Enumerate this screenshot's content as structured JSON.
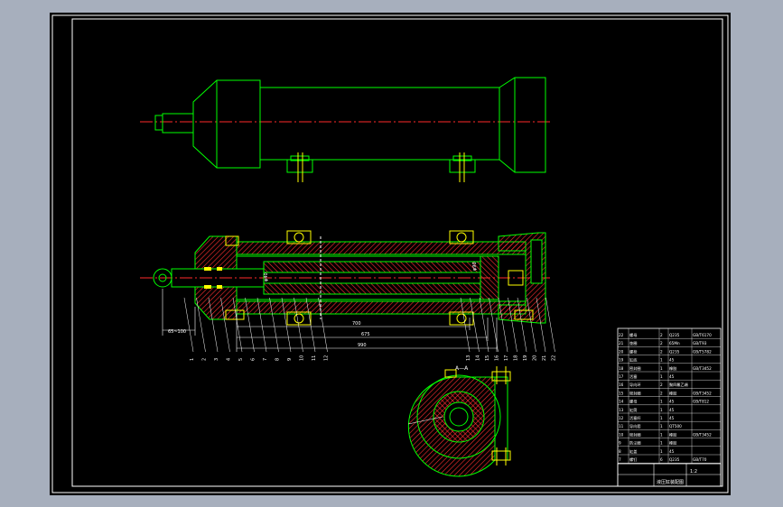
{
  "colors": {
    "background": "#a7afbd",
    "sheet": "#000000",
    "frame": "#ffffff",
    "geometry": "#00ff00",
    "centerline": "#ff2a2a",
    "hatch": "#ff3030",
    "yellow": "#ffff00",
    "text": "#ffffff"
  },
  "dimensions": {
    "stroke_dim": "65~100",
    "len_a": "700",
    "len_b": "675",
    "len_c": "990",
    "bore": "φ40",
    "rod": "φ90"
  },
  "section_mark": "A—A",
  "balloons_left": [
    "1",
    "2",
    "3",
    "4",
    "5",
    "6",
    "7",
    "8",
    "9",
    "10",
    "11",
    "12"
  ],
  "balloons_right": [
    "13",
    "14",
    "15",
    "16",
    "17",
    "18",
    "19",
    "20",
    "21",
    "22"
  ],
  "title_block": {
    "rows": [
      [
        "22",
        "螺母",
        "2",
        "Q235",
        "GB/T6170"
      ],
      [
        "21",
        "垫圈",
        "2",
        "65Mn",
        "GB/T93"
      ],
      [
        "20",
        "螺栓",
        "2",
        "Q235",
        "GB/T5782"
      ],
      [
        "19",
        "缸底",
        "1",
        "45",
        ""
      ],
      [
        "18",
        "密封圈",
        "1",
        "橡胶",
        "GB/T3452"
      ],
      [
        "17",
        "活塞",
        "1",
        "45",
        ""
      ],
      [
        "16",
        "导向环",
        "2",
        "聚四氟乙烯",
        ""
      ],
      [
        "15",
        "密封圈",
        "2",
        "橡胶",
        "GB/T3452"
      ],
      [
        "14",
        "螺母",
        "1",
        "45",
        "GB/T812"
      ],
      [
        "13",
        "缸筒",
        "1",
        "45",
        ""
      ],
      [
        "12",
        "活塞杆",
        "1",
        "45",
        ""
      ],
      [
        "11",
        "导向套",
        "1",
        "QT500",
        ""
      ],
      [
        "10",
        "密封圈",
        "1",
        "橡胶",
        "GB/T3452"
      ],
      [
        "9",
        "防尘圈",
        "1",
        "橡胶",
        ""
      ],
      [
        "8",
        "缸盖",
        "1",
        "45",
        ""
      ],
      [
        "7",
        "螺钉",
        "6",
        "Q235",
        "GB/T70"
      ]
    ],
    "name": "液压缸装配图",
    "scale": "1:2"
  }
}
